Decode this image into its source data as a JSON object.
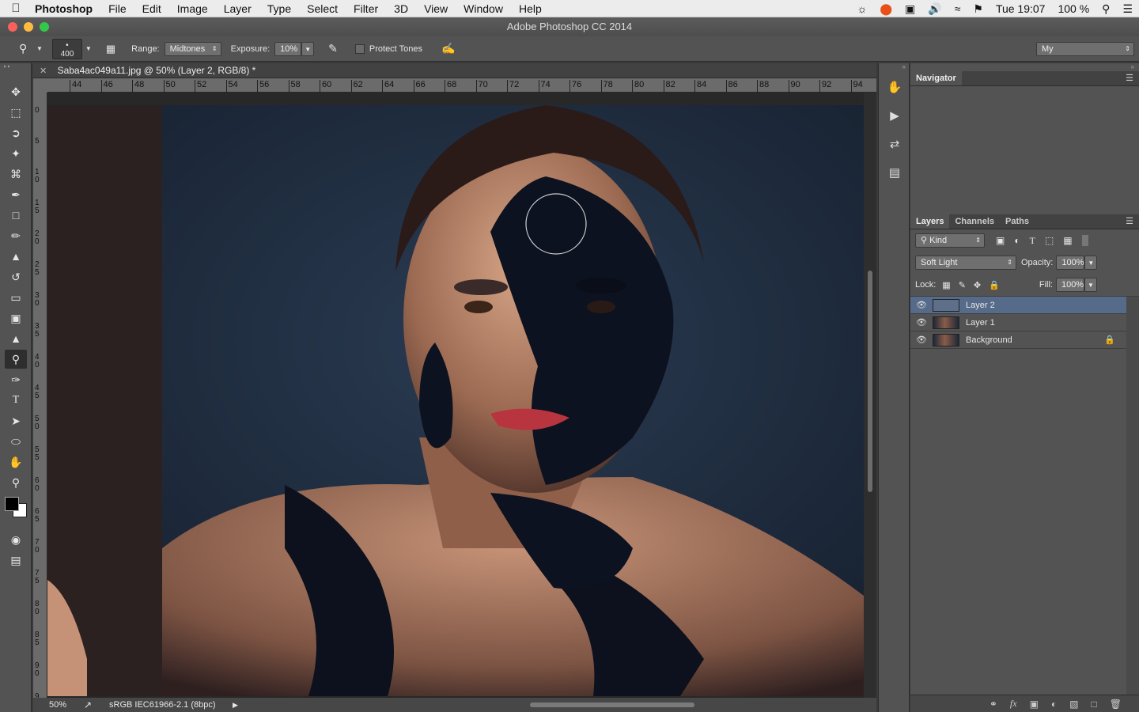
{
  "menubar": {
    "apple": "",
    "app": "Photoshop",
    "items": [
      "File",
      "Edit",
      "Image",
      "Layer",
      "Type",
      "Select",
      "Filter",
      "3D",
      "View",
      "Window",
      "Help"
    ],
    "status": {
      "clock": "Tue 19:07",
      "battery": "100 %"
    }
  },
  "window": {
    "title": "Adobe Photoshop CC 2014"
  },
  "options": {
    "brush_size": "400",
    "range_label": "Range:",
    "range_value": "Midtones",
    "exposure_label": "Exposure:",
    "exposure_value": "10%",
    "protect_tones": "Protect Tones",
    "workspace": "My"
  },
  "document": {
    "tab_title": "Saba4ac049a11.jpg @ 50% (Layer 2, RGB/8) *",
    "zoom": "50%",
    "profile": "sRGB IEC61966-2.1 (8bpc)"
  },
  "ruler": {
    "h": [
      "44",
      "46",
      "48",
      "50",
      "52",
      "54",
      "56",
      "58",
      "60",
      "62",
      "64",
      "66",
      "68",
      "70",
      "72",
      "74",
      "76",
      "78",
      "80",
      "82",
      "84",
      "86",
      "88",
      "90",
      "92",
      "94"
    ],
    "v": [
      "0",
      "5",
      "10",
      "15",
      "20",
      "25",
      "30",
      "35",
      "40",
      "45",
      "50",
      "55",
      "60",
      "65",
      "70",
      "75",
      "80",
      "85",
      "90",
      "9"
    ]
  },
  "navigator": {
    "title": "Navigator"
  },
  "layers_panel": {
    "tabs": [
      "Layers",
      "Channels",
      "Paths"
    ],
    "filter": "Kind",
    "blend_mode": "Soft Light",
    "opacity_label": "Opacity:",
    "opacity": "100%",
    "lock_label": "Lock:",
    "fill_label": "Fill:",
    "fill": "100%",
    "layers": [
      {
        "name": "Layer 2",
        "selected": true
      },
      {
        "name": "Layer 1",
        "selected": false
      },
      {
        "name": "Background",
        "selected": false,
        "locked": true
      }
    ]
  },
  "icons": {
    "tools": [
      "move-icon",
      "marquee-icon",
      "lasso-icon",
      "magic-wand-icon",
      "crop-icon",
      "eyedropper-icon",
      "healing-icon",
      "brush-icon",
      "stamp-icon",
      "history-brush-icon",
      "eraser-icon",
      "gradient-icon",
      "blur-icon",
      "dodge-icon",
      "pen-icon",
      "type-icon",
      "path-select-icon",
      "ellipse-icon",
      "hand-icon",
      "zoom-icon"
    ]
  },
  "colors": {
    "accent": "#566a8a",
    "panel": "#535353",
    "canvas_bg": "#1d2838"
  }
}
